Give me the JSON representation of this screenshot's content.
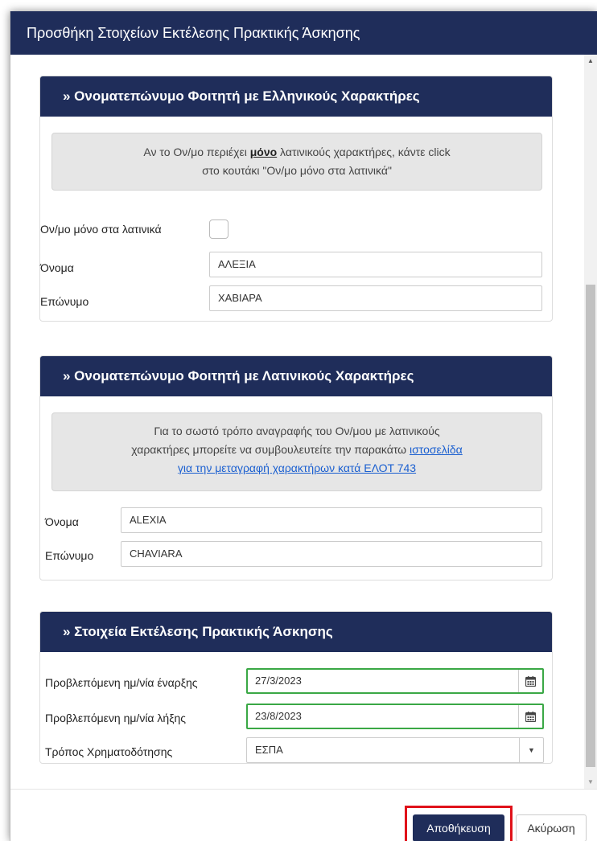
{
  "modal": {
    "title": "Προσθήκη Στοιχείων Εκτέλεσης Πρακτικής Άσκησης"
  },
  "greek_panel": {
    "heading": "» Ονοματεπώνυμο Φοιτητή με Ελληνικούς Χαρακτήρες",
    "notice_pre": "Αν το Ον/μο περιέχει ",
    "notice_bold": "μόνο",
    "notice_post": " λατινικούς χαρακτήρες, κάντε click",
    "notice_line2": "στο κουτάκι \"Ον/μο μόνο στα λατινικά\"",
    "latin_only_label": "Ον/μο μόνο στα λατινικά",
    "latin_only_checked": false,
    "first_name_label": "Όνομα",
    "first_name_value": "ΑΛΕΞΙΑ",
    "last_name_label": "Επώνυμο",
    "last_name_value": "ΧΑΒΙΑΡΑ"
  },
  "latin_panel": {
    "heading": "» Ονοματεπώνυμο Φοιτητή με Λατινικούς Χαρακτήρες",
    "notice_line1": "Για το σωστό τρόπο αναγραφής του Ον/μου με λατινικούς",
    "notice_line2_pre": "χαρακτήρες μπορείτε να συμβουλευτείτε την παρακάτω ",
    "notice_link1": "ιστοσελίδα",
    "notice_link2": "για την μεταγραφή χαρακτήρων κατά ΕΛΟΤ 743",
    "first_name_label": "Όνομα",
    "first_name_value": "ALEXIA",
    "last_name_label": "Επώνυμο",
    "last_name_value": "CHAVIARA"
  },
  "execution_panel": {
    "heading": "» Στοιχεία Εκτέλεσης Πρακτικής Άσκησης",
    "start_label": "Προβλεπόμενη ημ/νία έναρξης",
    "start_value": "27/3/2023",
    "end_label": "Προβλεπόμενη ημ/νία λήξης",
    "end_value": "23/8/2023",
    "funding_label": "Τρόπος Χρηματοδότησης",
    "funding_value": "ΕΣΠΑ"
  },
  "footer": {
    "save_label": "Αποθήκευση",
    "cancel_label": "Ακύρωση"
  },
  "colors": {
    "header": "#1f2d5a",
    "valid_border": "#3aa845",
    "highlight": "#e0121a",
    "link": "#1a5fd0"
  }
}
